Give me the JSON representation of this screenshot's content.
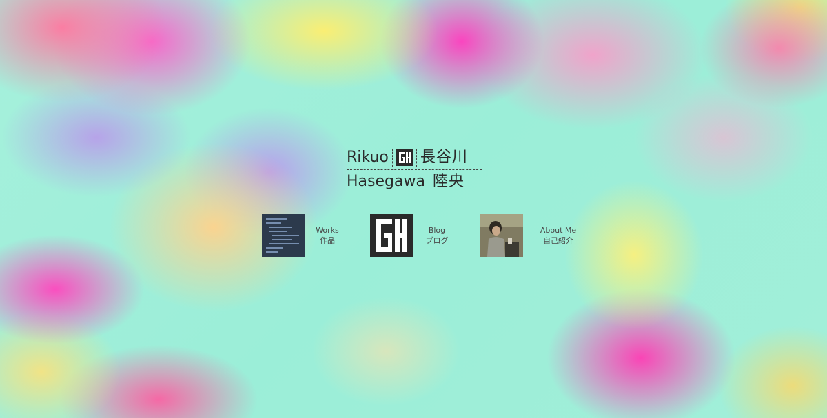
{
  "colors": {
    "text": "#2a2a2a",
    "background_base": "#9ef0d8",
    "logo": "#2a2a2a"
  },
  "title": {
    "name_en_first": "Rikuo",
    "name_en_last": "Hasegawa",
    "name_jp_family": "長谷川",
    "name_jp_given": "陸央",
    "logo_icon": "gh-logo"
  },
  "nav": [
    {
      "label_en": "Works",
      "label_jp": "作品",
      "thumbnail": "code-editor-screenshot"
    },
    {
      "label_en": "Blog",
      "label_jp": "ブログ",
      "thumbnail": "gh-logo"
    },
    {
      "label_en": "About Me",
      "label_jp": "自己紹介",
      "thumbnail": "portrait-photo"
    }
  ]
}
